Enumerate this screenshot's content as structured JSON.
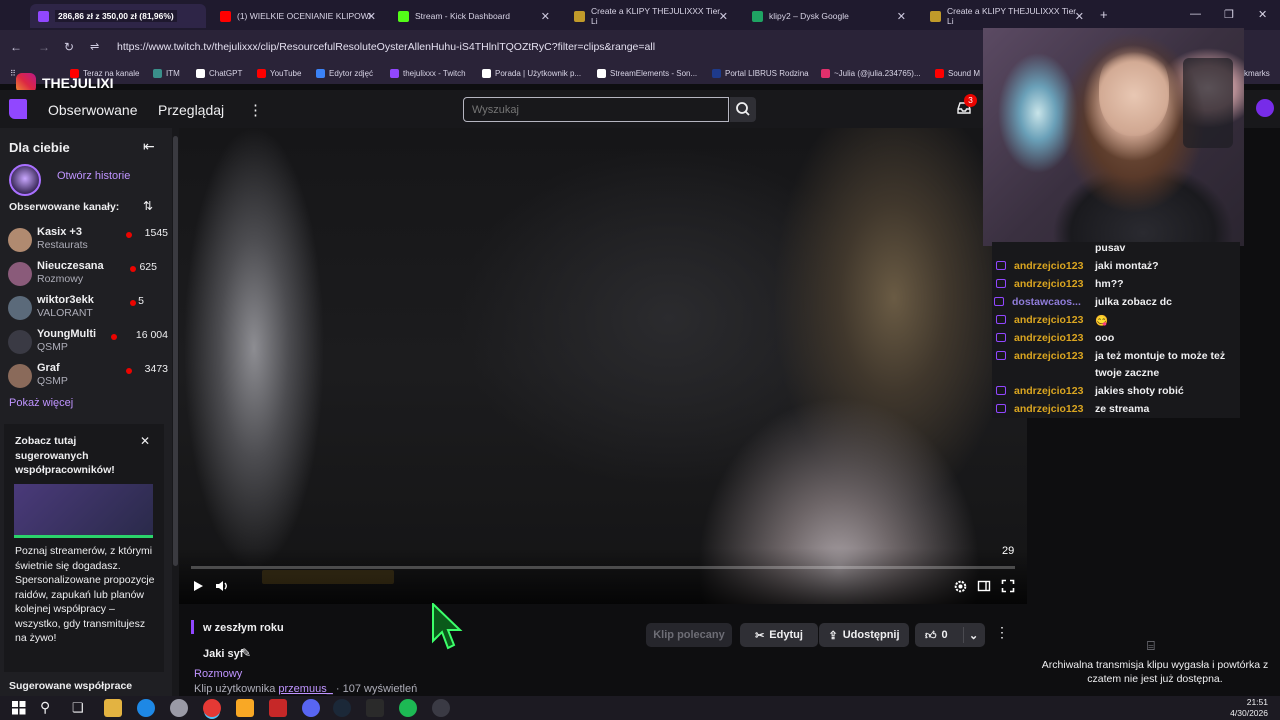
{
  "browser": {
    "tabs": [
      {
        "label": "286,86 zł z 350,00 zł (81,96%)",
        "color": "#d8d4e6"
      },
      {
        "label": "(1) WIELKIE OCENIANIE KLIPOW!",
        "color": "#ff0000"
      },
      {
        "label": "Stream - Kick Dashboard",
        "color": "#53fc18"
      },
      {
        "label": "Create a KLIPY THEJULIXXX Tier Li",
        "color": "#c09a2a"
      },
      {
        "label": "klipy2 – Dysk Google",
        "color": "#1fa463"
      },
      {
        "label": "Create a KLIPY THEJULIXXX Tier Li",
        "color": "#c09a2a"
      }
    ],
    "new_tab": "+",
    "url": "https://www.twitch.tv/thejulixxx/clip/ResourcefulResoluteOysterAllenHuhu-iS4THlnlTQOZtRyC?filter=clips&range=all",
    "bookmarks": [
      {
        "label": "Teraz na kanale",
        "color": "#ff0000"
      },
      {
        "label": "ITM",
        "color": "#3a8f8a"
      },
      {
        "label": "ChatGPT",
        "color": "#ffffff"
      },
      {
        "label": "YouTube",
        "color": "#ff0000"
      },
      {
        "label": "Edytor zdjęć",
        "color": "#3b82f6"
      },
      {
        "label": "thejulixxx - Twitch",
        "color": "#9147ff"
      },
      {
        "label": "Porada | Użytkownik p...",
        "color": "#ffffff"
      },
      {
        "label": "StreamElements - Son...",
        "color": "#ffffff"
      },
      {
        "label": "Portal LIBRUS Rodzina",
        "color": "#1e3a8a"
      },
      {
        "label": "~Julia (@julia.234765)...",
        "color": "#e1306c"
      },
      {
        "label": "Sound M",
        "color": "#ff0000"
      }
    ],
    "bookmarks_more": "kmarks"
  },
  "overlay": {
    "instagram_name": "THEJULIXI",
    "donation_goal": "286,86 zł z 350,00 zł (81,96%)"
  },
  "header": {
    "nav_following": "Obserwowane",
    "nav_browse": "Przeglądaj",
    "more": "⋮",
    "search_placeholder": "Wyszukaj",
    "notification_count": "3"
  },
  "sidebar": {
    "title": "Dla ciebie",
    "story_label": "Otwórz historie",
    "followed_title": "Obserwowane kanały:",
    "channels": [
      {
        "name": "Kasix +3",
        "game": "Restaurats",
        "viewers": "1545",
        "avatar": "#b08a70"
      },
      {
        "name": "Nieuczesana",
        "game": "Rozmowy",
        "viewers": "625",
        "avatar": "#8a5b7a"
      },
      {
        "name": "wiktor3ekk",
        "game": "VALORANT",
        "viewers": "5",
        "avatar": "#5b6a7a"
      },
      {
        "name": "YoungMulti",
        "game": "QSMP",
        "viewers": "16 004",
        "avatar": "#3a3a44"
      },
      {
        "name": "Graf",
        "game": "QSMP",
        "viewers": "3473",
        "avatar": "#8a6a5a"
      }
    ],
    "show_more": "Pokaż więcej",
    "promo_title": "Zobacz tutaj sugerowanych współpracowników!",
    "promo_text": "Poznaj streamerów, z którymi świetnie się dogadasz. Spersonalizowane propozycje raidów, zapukań lub planów kolejnej współpracy – wszystko, gdy transmitujesz na żywo!",
    "suggested_title": "Sugerowane współprace"
  },
  "video": {
    "duration": "29",
    "time_label": "w zeszłym roku",
    "clip_title": "Jaki syf",
    "category": "Rozmowy",
    "author_prefix": "Klip użytkownika",
    "author": "przemuus_",
    "views": "· 107 wyświetleń",
    "btn_recommended": "Klip polecany",
    "btn_edit": "Edytuj",
    "btn_share": "Udostępnij",
    "likes": "0"
  },
  "chat": {
    "messages": [
      {
        "user": "",
        "text": "pusav"
      },
      {
        "user": "andrzejcio123",
        "text": "jaki montaż?"
      },
      {
        "user": "andrzejcio123",
        "text": "hm??"
      },
      {
        "user": "dostawcaos...",
        "text": "julka zobacz dc"
      },
      {
        "user": "andrzejcio123",
        "text": "😋"
      },
      {
        "user": "andrzejcio123",
        "text": "ooo"
      },
      {
        "user": "andrzejcio123",
        "text": "ja też montuje to może też"
      },
      {
        "user": "",
        "text": "twoje zaczne"
      },
      {
        "user": "andrzejcio123",
        "text": "jakies shoty robić"
      },
      {
        "user": "andrzejcio123",
        "text": "ze streama"
      }
    ],
    "archive_notice": "Archiwalna transmisja klipu wygasła i powtórka z czatem nie jest już dostępna."
  },
  "taskbar": {
    "time": "21:51",
    "date": "4/30/2026"
  }
}
